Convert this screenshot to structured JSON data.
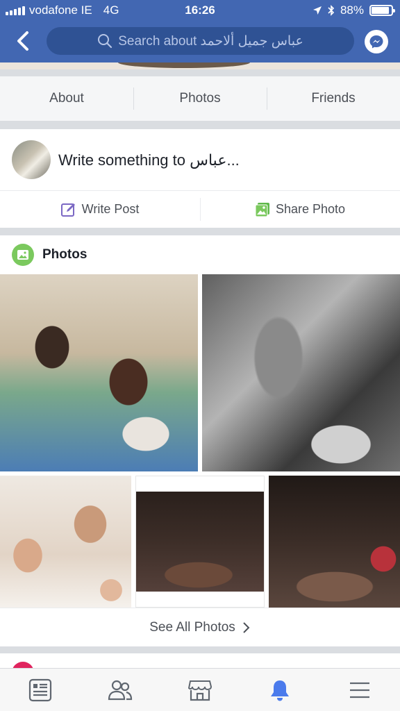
{
  "status_bar": {
    "carrier": "vodafone IE",
    "network": "4G",
    "time": "16:26",
    "battery": "88%",
    "battery_level": 0.88
  },
  "header": {
    "search_text": "Search about عباس جميل ألاحمد",
    "back_icon": "chevron-left-icon",
    "messenger_icon": "messenger-icon"
  },
  "profile_tabs": [
    {
      "label": "About"
    },
    {
      "label": "Photos"
    },
    {
      "label": "Friends"
    }
  ],
  "composer": {
    "placeholder": "Write something to عباس...",
    "write_post_label": "Write Post",
    "share_photo_label": "Share Photo"
  },
  "photos_section": {
    "title": "Photos",
    "see_all_label": "See All Photos"
  },
  "bottom_nav": [
    {
      "icon": "news-feed-icon",
      "active": false
    },
    {
      "icon": "friends-icon",
      "active": false
    },
    {
      "icon": "marketplace-icon",
      "active": false
    },
    {
      "icon": "notifications-icon",
      "active": true
    },
    {
      "icon": "menu-icon",
      "active": false
    }
  ],
  "colors": {
    "header_blue": "#4267b2",
    "active_blue": "#4b7bec",
    "photos_green": "#7bc95e",
    "write_post_purple": "#7b68c4"
  }
}
